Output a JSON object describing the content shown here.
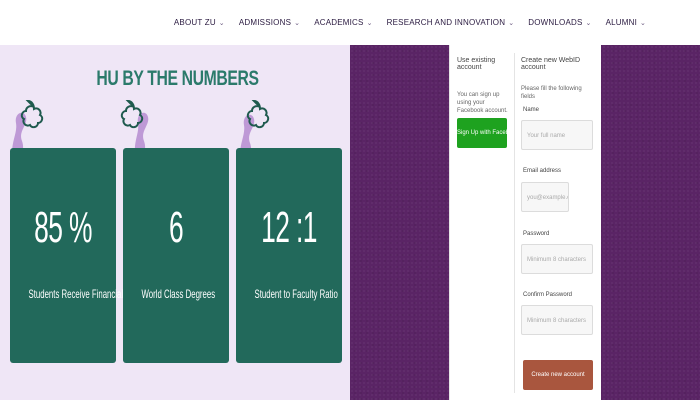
{
  "nav": {
    "items": [
      {
        "label": "ABOUT ZU"
      },
      {
        "label": "ADMISSIONS"
      },
      {
        "label": "ACADEMICS"
      },
      {
        "label": "RESEARCH AND INNOVATION"
      },
      {
        "label": "DOWNLOADS"
      },
      {
        "label": "ALUMNI"
      }
    ]
  },
  "stats": {
    "title": "HU BY THE NUMBERS",
    "cards": [
      {
        "value": "85 %",
        "label": "Students Receive Financial Support"
      },
      {
        "value": "6",
        "label": "World Class Degrees"
      },
      {
        "value": "12 :1",
        "label": "Student to Faculty Ratio"
      }
    ]
  },
  "signup": {
    "existing": {
      "heading": "Use existing account",
      "note": "You can sign up using your Facebook account.",
      "facebook_button": "Sign Up with Facebook"
    },
    "new": {
      "heading": "Create new WebID account",
      "required_note": "Please fill the following fields",
      "name_label": "Name",
      "name_placeholder": "Your full name",
      "email_label": "Email address",
      "email_placeholder": "you@example.com",
      "password_label": "Password",
      "password_placeholder": "Minimum 8 characters",
      "confirm_label": "Confirm Password",
      "confirm_placeholder": "Minimum 8 characters",
      "create_button": "Create new account"
    }
  },
  "colors": {
    "card_bg": "#22695b",
    "title_color": "#2b7a6b",
    "felt_bg": "#5a2465",
    "facebook_btn": "#1ea21f",
    "create_btn": "#a9563e"
  }
}
